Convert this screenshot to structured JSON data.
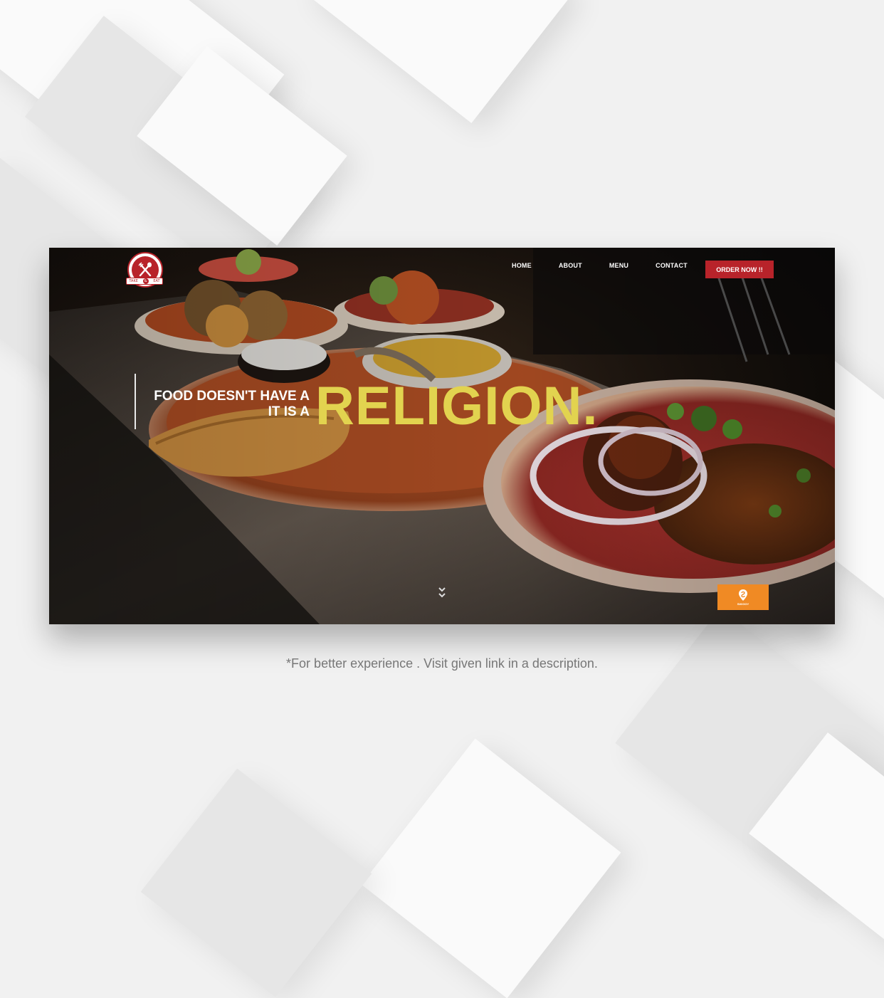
{
  "brand": {
    "logo_left_text": "TAKE",
    "logo_right_text": "EAT",
    "logo_amp": "&",
    "accent_color": "#b8232a"
  },
  "nav": {
    "links": [
      "HOME",
      "ABOUT",
      "MENU",
      "CONTACT"
    ],
    "order_button": "ORDER NOW !!"
  },
  "hero": {
    "line1": "FOOD DOESN'T HAVE A",
    "line2": "IT IS A",
    "headline": "RELIGION.",
    "headline_color": "#e2d34f"
  },
  "badge": {
    "label": "SWIGGY",
    "icon": "swiggy-icon",
    "color": "#f08a24"
  },
  "scroll_icon": "double-chevron-down-icon",
  "caption": "*For better experience . Visit given link in a description."
}
